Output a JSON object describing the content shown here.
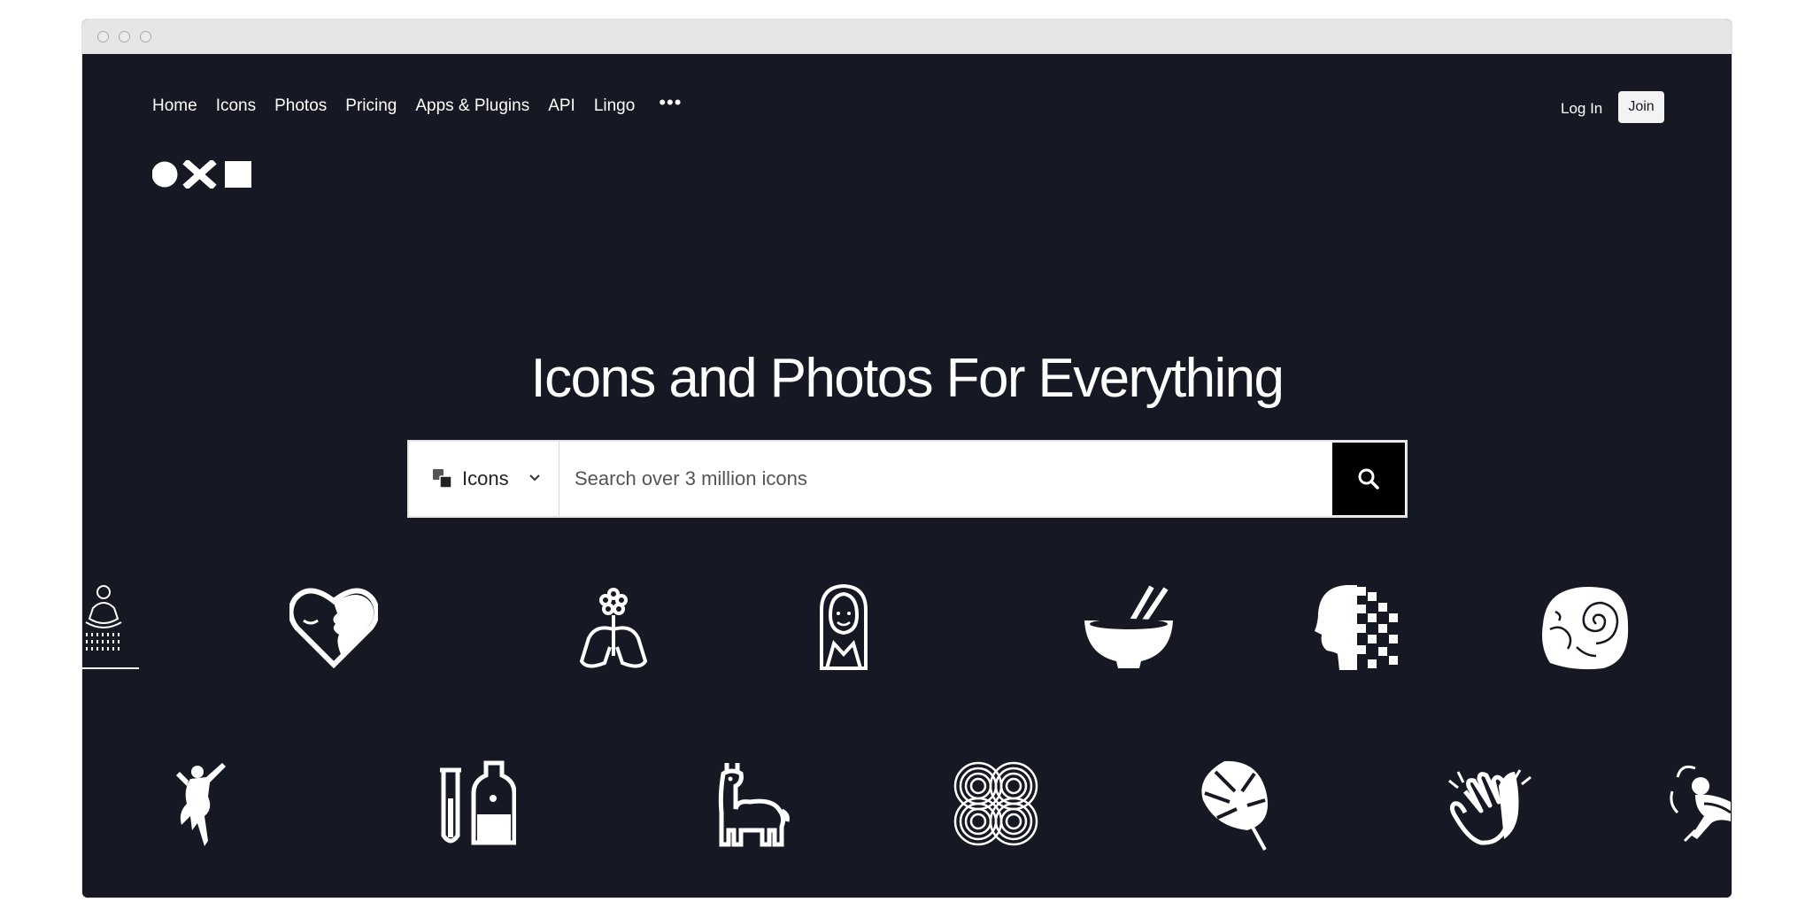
{
  "nav": {
    "items": [
      {
        "label": "Home"
      },
      {
        "label": "Icons"
      },
      {
        "label": "Photos"
      },
      {
        "label": "Pricing"
      },
      {
        "label": "Apps & Plugins"
      },
      {
        "label": "API"
      },
      {
        "label": "Lingo"
      }
    ],
    "more_label": "•••"
  },
  "auth": {
    "login_label": "Log In",
    "join_label": "Join"
  },
  "hero": {
    "headline": "Icons and Photos For Everything"
  },
  "search": {
    "type_label": "Icons",
    "placeholder": "Search over 3 million icons"
  },
  "showcase_icons": [
    "meditation-rain-icon",
    "heart-face-icon",
    "flower-lungs-icon",
    "veiled-woman-icon",
    "bowl-chopsticks-icon",
    "pixel-head-icon",
    "ammonite-fossil-icon",
    "dancer-icon",
    "test-tube-bottle-icon",
    "llama-icon",
    "concentric-circles-icon",
    "monstera-leaf-icon",
    "clapping-hands-icon",
    "skater-icon"
  ],
  "colors": {
    "background": "#161923",
    "foreground": "#ffffff",
    "search_button": "#000000"
  }
}
